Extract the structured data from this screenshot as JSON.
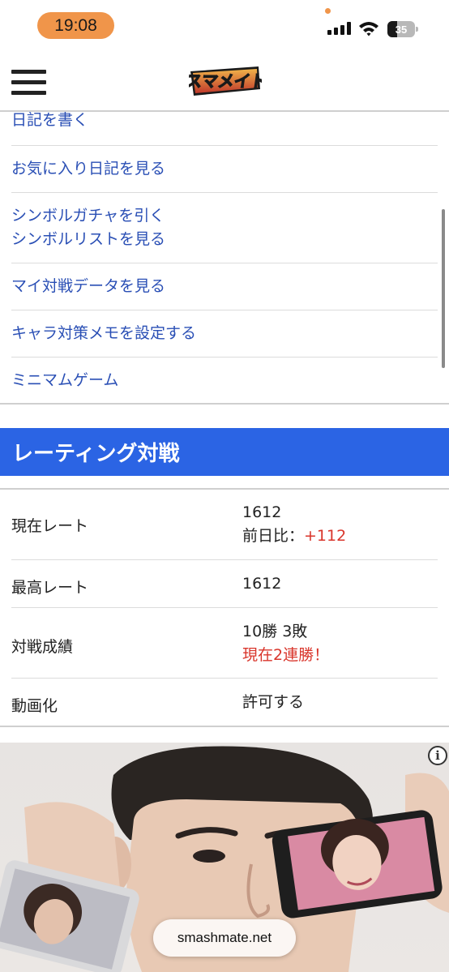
{
  "status_bar": {
    "time": "19:08",
    "battery": "35",
    "battery_level_percent": 35
  },
  "header": {
    "logo_alt": "スマメイト",
    "menu_icon": "hamburger-menu-icon"
  },
  "menu": {
    "items": [
      {
        "label": "日記を書く"
      },
      {
        "label": "お気に入り日記を見る"
      },
      {
        "label": "シンボルガチャを引く",
        "label2": "シンボルリストを見る"
      },
      {
        "label": "マイ対戦データを見る"
      },
      {
        "label": "キャラ対策メモを設定する"
      },
      {
        "label": "ミニマムゲーム"
      }
    ]
  },
  "rating": {
    "title": "レーティング対戦",
    "rows": [
      {
        "key": "現在レート",
        "value": "1612",
        "sub_prefix": "前日比：",
        "sub_value": "+112"
      },
      {
        "key": "最高レート",
        "value": "1612"
      },
      {
        "key": "対戦成績",
        "value": "10勝 3敗",
        "sub_value": "現在2連勝！"
      },
      {
        "key": "動画化",
        "value": "許可する"
      }
    ]
  },
  "ad": {
    "info_icon": "info-icon"
  },
  "url_bar": {
    "domain": "smashmate.net"
  },
  "colors": {
    "accent_blue": "#2b64e4",
    "link_blue": "#2a4fb5",
    "highlight_red": "#d9352b",
    "time_pill": "#f0954a"
  }
}
